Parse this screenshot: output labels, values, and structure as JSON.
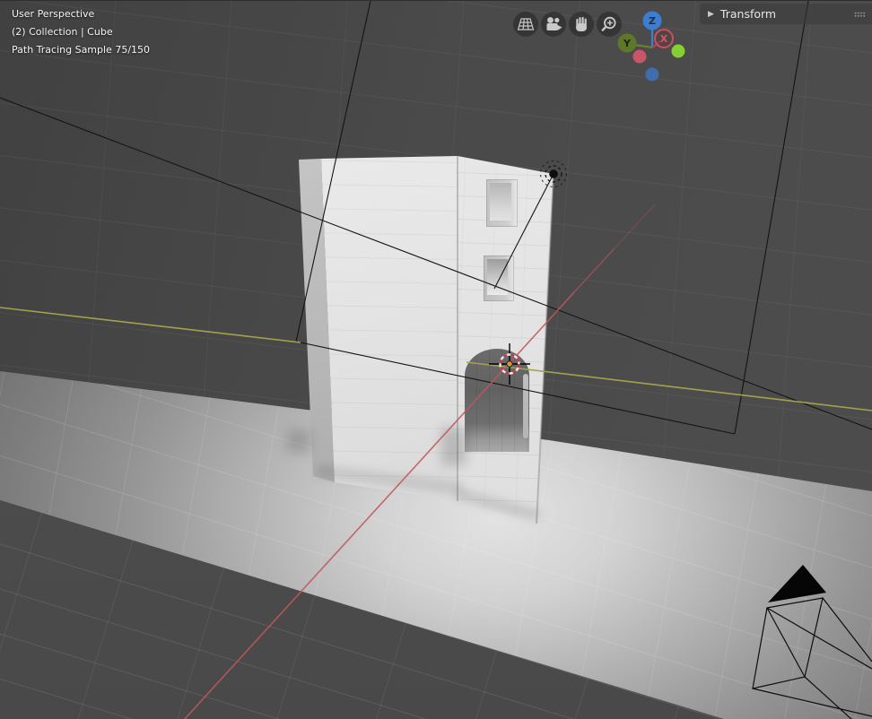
{
  "viewport": {
    "info_overlay": {
      "view_label": "User Perspective",
      "context_label": "(2) Collection | Cube",
      "render_status": "Path Tracing Sample 75/150"
    },
    "toolbar": {
      "buttons": [
        {
          "name": "toggle-perspective",
          "icon": "grid-plane-icon"
        },
        {
          "name": "camera-view",
          "icon": "camera-icon"
        },
        {
          "name": "pan-view",
          "icon": "hand-icon"
        },
        {
          "name": "zoom-view",
          "icon": "magnifier-plus-icon"
        }
      ]
    },
    "nav_gizmo": {
      "axes": [
        {
          "label": "Z"
        },
        {
          "label": "Y"
        },
        {
          "label": "X"
        }
      ]
    },
    "sidebar": {
      "arrow": "▶",
      "label": "Transform"
    }
  },
  "scene": {
    "objects": [
      "building-mesh",
      "floor-plane",
      "sun-light",
      "camera",
      "3d-cursor"
    ]
  },
  "colors": {
    "viewport_bg": "#484848",
    "axis_x": "#c25560",
    "axis_y": "#a3a24c",
    "gizmo_z": "#3c7dd2",
    "gizmo_y": "#5f7729",
    "gizmo_x": "#cb4f5f",
    "overlay_text": "#f5f5f5"
  }
}
